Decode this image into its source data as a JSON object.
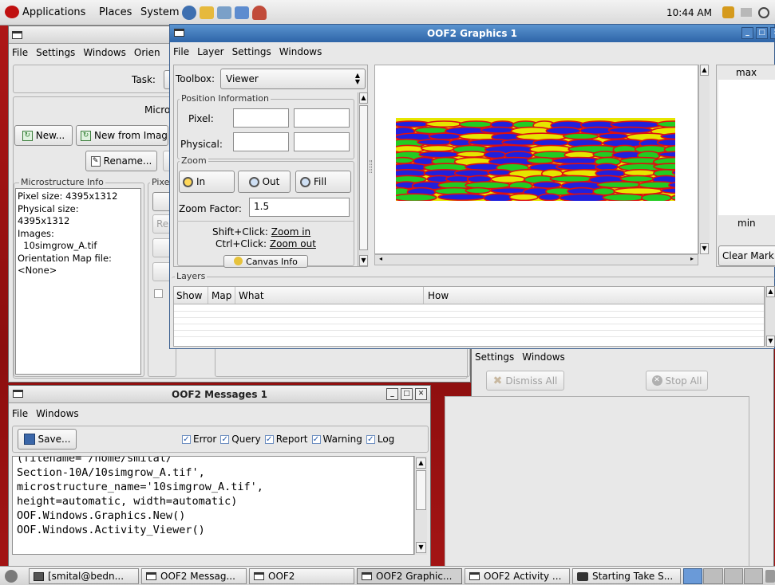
{
  "top_panel": {
    "menus": [
      "Applications",
      "Places",
      "System"
    ],
    "clock": "10:44 AM"
  },
  "main_window": {
    "menu": [
      "File",
      "Settings",
      "Windows",
      "Orien"
    ],
    "task_label": "Task:",
    "micro_heading": "Micro",
    "buttons": {
      "new": "New...",
      "new_from_image": "New from Imag",
      "rename": "Rename..."
    },
    "info_legend": "Microstructure Info",
    "pixel_legend": "Pixe",
    "info_lines": [
      "Pixel size: 4395x1312",
      "Physical size:",
      "4395x1312",
      "Images:",
      "  10simgrow_A.tif",
      "Orientation Map file:",
      "<None>"
    ],
    "side_stub": "Re"
  },
  "graphics_window": {
    "title": "OOF2 Graphics 1",
    "menu": [
      "File",
      "Layer",
      "Settings",
      "Windows"
    ],
    "toolbox_label": "Toolbox:",
    "toolbox_value": "Viewer",
    "position_legend": "Position Information",
    "pixel_label": "Pixel:",
    "physical_label": "Physical:",
    "zoom_legend": "Zoom",
    "zoom_in": "In",
    "zoom_out": "Out",
    "zoom_fill": "Fill",
    "zoom_factor_label": "Zoom Factor:",
    "zoom_factor_value": "1.5",
    "hint_shift": "Shift+Click:",
    "hint_shift_action": "Zoom in",
    "hint_ctrl": "Ctrl+Click:",
    "hint_ctrl_action": "Zoom out",
    "canvas_info": "Canvas Info",
    "layers_legend": "Layers",
    "layer_columns": [
      "Show",
      "Map",
      "What",
      "How"
    ],
    "scale_max": "max",
    "scale_min": "min",
    "clear_mark": "Clear Mark"
  },
  "activity_window": {
    "menu": [
      "Settings",
      "Windows"
    ],
    "dismiss_all": "Dismiss All",
    "stop_all": "Stop All"
  },
  "messages_window": {
    "title": "OOF2 Messages 1",
    "menu": [
      "File",
      "Windows"
    ],
    "save": "Save...",
    "filters": [
      "Error",
      "Query",
      "Report",
      "Warning",
      "Log"
    ],
    "log_lines": [
      "(filename='/home/smital/",
      "Section-10A/10simgrow_A.tif',",
      "microstructure_name='10simgrow_A.tif',",
      "height=automatic, width=automatic)",
      "OOF.Windows.Graphics.New()",
      "OOF.Windows.Activity_Viewer()"
    ]
  },
  "taskbar": {
    "items": [
      "[smital@bedn...",
      "OOF2 Messag...",
      "OOF2",
      "OOF2 Graphic...",
      "OOF2 Activity ...",
      "Starting Take S..."
    ]
  },
  "colors": {
    "title_active": "#3a72b4",
    "desktop": "#a01515",
    "micro_yellow": "#e6e600",
    "micro_green": "#22cc22",
    "micro_blue": "#2020dd",
    "micro_red": "#dd1111"
  }
}
